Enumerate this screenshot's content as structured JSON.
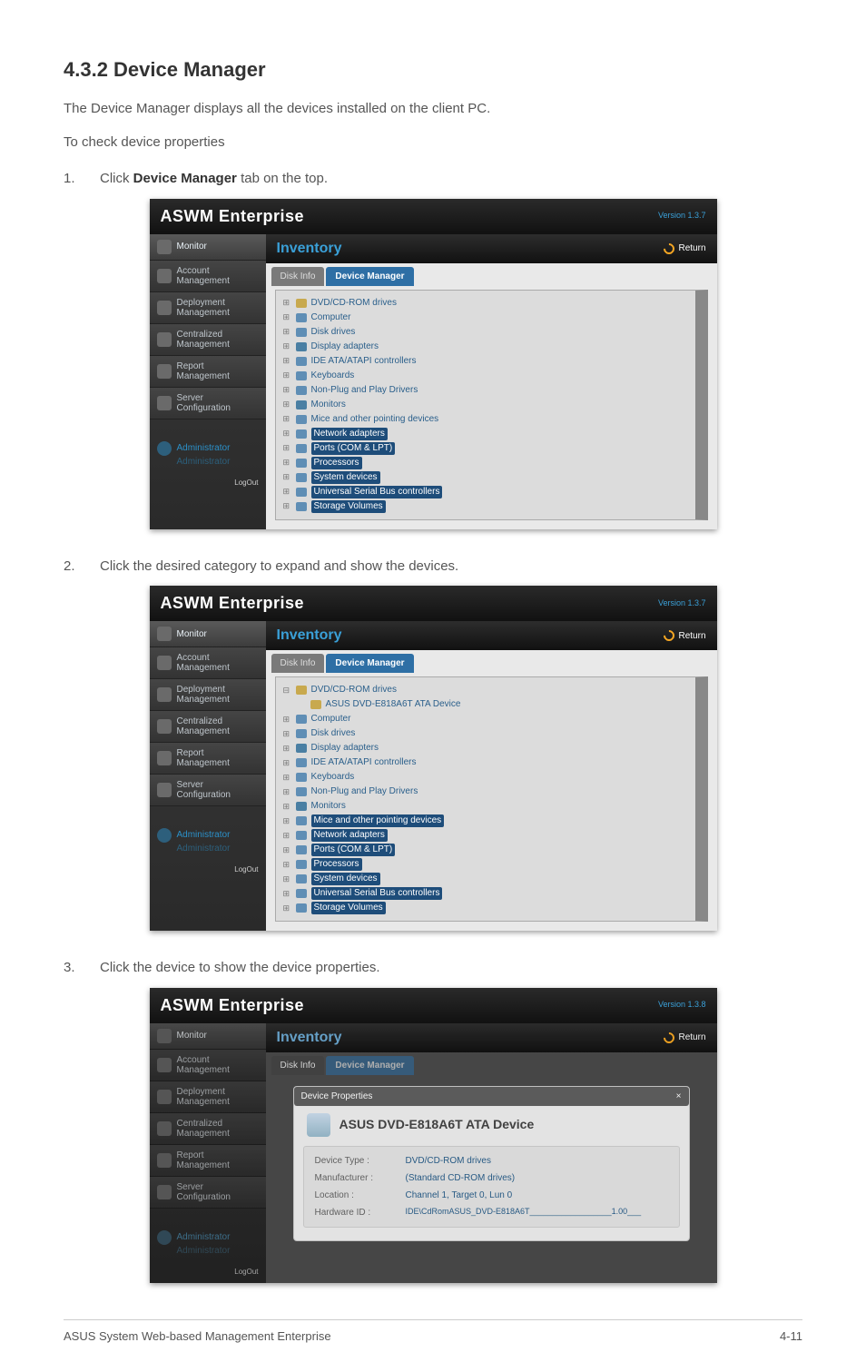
{
  "heading": "4.3.2      Device Manager",
  "intro1": "The Device Manager displays all the devices installed on the client PC.",
  "intro2": "To check device properties",
  "step1_num": "1.",
  "step1_pre": "Click ",
  "step1_bold": "Device Manager",
  "step1_post": " tab on the top.",
  "step2_num": "2.",
  "step2_text": "Click the desired category to expand and show the devices.",
  "step3_num": "3.",
  "step3_text": "Click the device to show the device properties.",
  "app_title": "ASWM Enterprise",
  "version": "Version 1.3.7",
  "version3": "Version 1.3.8",
  "sidebar": {
    "items": [
      "Monitor",
      "Account\nManagement",
      "Deployment\nManagement",
      "Centralized\nManagement",
      "Report\nManagement",
      "Server\nConfiguration"
    ],
    "admin_line1": "Administrator",
    "admin_line2": "Administrator",
    "logout": "LogOut"
  },
  "main": {
    "header_title": "Inventory",
    "return": "Return",
    "tab_inactive": "Disk Info",
    "tab_active": "Device Manager"
  },
  "tree1": {
    "expand": "⊞",
    "collapse": "⊟",
    "items": [
      "DVD/CD-ROM drives",
      "Computer",
      "Disk drives",
      "Display adapters",
      "IDE ATA/ATAPI controllers",
      "Keyboards",
      "Non-Plug and Play Drivers",
      "Monitors",
      "Mice and other pointing devices",
      "Network adapters",
      "Ports (COM & LPT)",
      "Processors",
      "System devices",
      "Universal Serial Bus controllers",
      "Storage Volumes"
    ]
  },
  "tree2": {
    "root": "DVD/CD-ROM drives",
    "child": "ASUS DVD-E818A6T ATA Device",
    "items": [
      "Computer",
      "Disk drives",
      "Display adapters",
      "IDE ATA/ATAPI controllers",
      "Keyboards",
      "Non-Plug and Play Drivers",
      "Monitors",
      "Mice and other pointing devices",
      "Network adapters",
      "Ports (COM & LPT)",
      "Processors",
      "System devices",
      "Universal Serial Bus controllers",
      "Storage Volumes"
    ]
  },
  "panel": {
    "head": "Device Properties",
    "close": "×",
    "title": "ASUS DVD-E818A6T ATA Device",
    "fields": [
      {
        "label": "Device Type :",
        "value": "DVD/CD-ROM drives"
      },
      {
        "label": "Manufacturer :",
        "value": "(Standard CD-ROM drives)"
      },
      {
        "label": "Location :",
        "value": "Channel 1, Target 0, Lun 0"
      },
      {
        "label": "Hardware ID :",
        "value": "IDE\\CdRomASUS_DVD-E818A6T__________________1.00___"
      }
    ]
  },
  "footer": {
    "left": "ASUS System Web-based Management Enterprise",
    "right": "4-11"
  }
}
